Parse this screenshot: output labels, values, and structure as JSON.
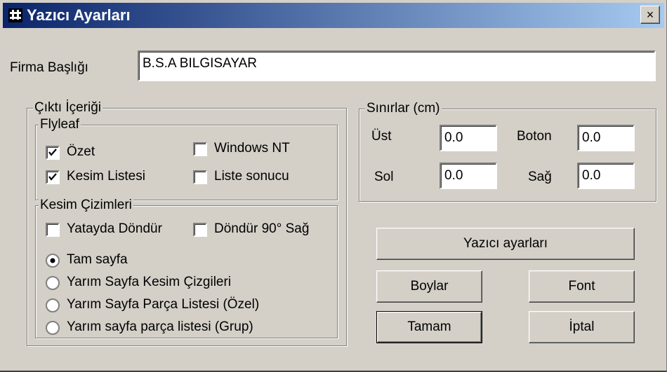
{
  "window": {
    "title": "Yazıcı Ayarları",
    "close_label": "×"
  },
  "company": {
    "label": "Firma Başlığı",
    "value": "B.S.A BILGISAYAR"
  },
  "output": {
    "title": "Çıktı İçeriği",
    "flyleaf": {
      "title": "Flyleaf",
      "items": [
        {
          "label": "Özet",
          "checked": true
        },
        {
          "label": "Kesim Listesi",
          "checked": true
        },
        {
          "label": "Windows NT",
          "checked": false
        },
        {
          "label": "Liste sonucu",
          "checked": false
        }
      ]
    },
    "drawings": {
      "title": "Kesim Çizimleri",
      "checks": [
        {
          "label": "Yatayda Döndür",
          "checked": false
        },
        {
          "label": "Döndür 90° Sağ",
          "checked": false
        }
      ],
      "radios": [
        {
          "label": "Tam sayfa",
          "selected": true
        },
        {
          "label": "Yarım Sayfa Kesim Çizgileri",
          "selected": false
        },
        {
          "label": "Yarım Sayfa Parça Listesi (Özel)",
          "selected": false
        },
        {
          "label": "Yarım sayfa parça listesi (Grup)",
          "selected": false
        }
      ]
    }
  },
  "margins": {
    "title": "Sınırlar (cm)",
    "top_label": "Üst",
    "top_value": "0.0",
    "bottom_label": "Boton",
    "bottom_value": "0.0",
    "left_label": "Sol",
    "left_value": "0.0",
    "right_label": "Sağ",
    "right_value": "0.0"
  },
  "buttons": {
    "printer_settings": "Yazıcı ayarları",
    "sizes": "Boylar",
    "font": "Font",
    "ok": "Tamam",
    "cancel": "İptal"
  },
  "colors": {
    "title_start": "#0a246a",
    "title_end": "#a6caf0",
    "face": "#d4d0c8"
  }
}
